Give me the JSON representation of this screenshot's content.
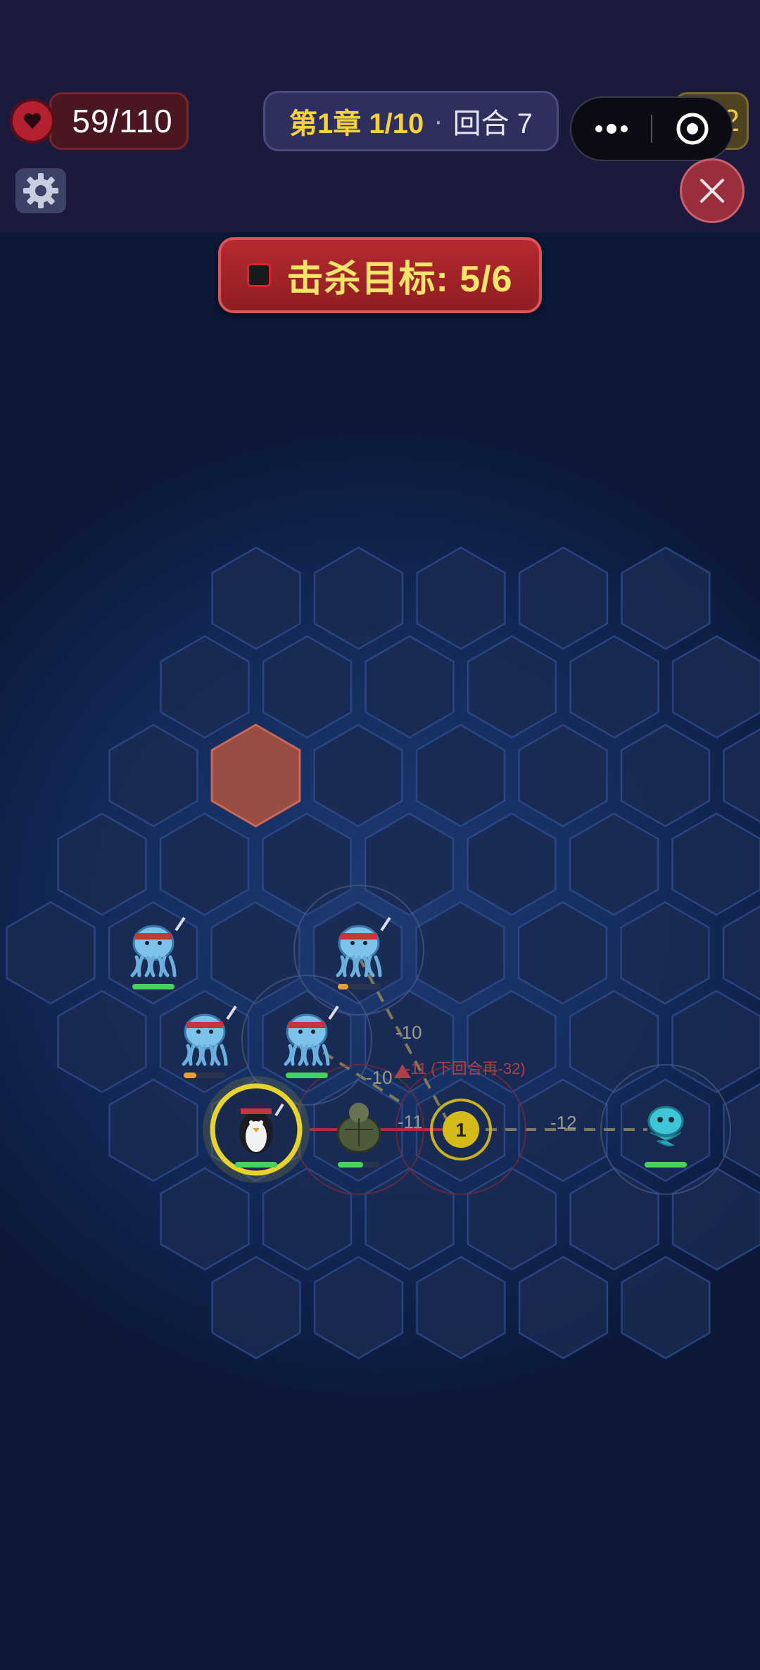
{
  "hud": {
    "hp": "59/110",
    "chapter": "第1章 1/10",
    "separator": "·",
    "round": "回合 7",
    "coins": "32"
  },
  "objective": {
    "label": "击杀目标: 5/6"
  },
  "board": {
    "damage_labels": [
      "-10",
      "-10",
      "-11",
      "-12"
    ],
    "warning_text": "-11 (下回合再-32)",
    "marker_number": "1"
  },
  "colors": {
    "hex_fill": "#1a2a52",
    "hex_stroke": "#2d4a8a",
    "hex_highlight": "#a8503f",
    "banner_text": "#f7e46a"
  },
  "units": [
    {
      "type": "jellyfish-enemy",
      "hp": 1.0
    },
    {
      "type": "jellyfish-enemy",
      "hp": 0.25
    },
    {
      "type": "jellyfish-enemy",
      "hp": 0.3
    },
    {
      "type": "jellyfish-enemy",
      "hp": 1.0
    },
    {
      "type": "penguin-player",
      "hp": 1.0
    },
    {
      "type": "turtle-ally",
      "hp": 0.6
    },
    {
      "type": "water-spirit-enemy",
      "hp": 1.0
    }
  ]
}
